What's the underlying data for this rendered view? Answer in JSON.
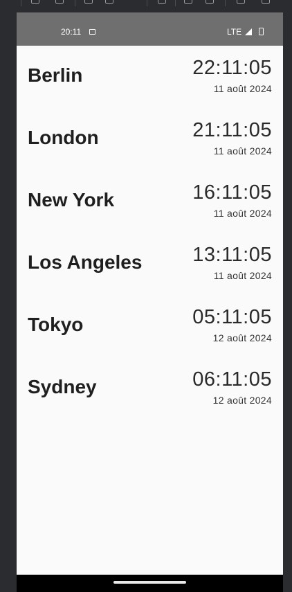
{
  "status_bar": {
    "time": "20:11",
    "network": "LTE"
  },
  "clocks": [
    {
      "city": "Berlin",
      "time": "22:11:05",
      "date": "11 août 2024"
    },
    {
      "city": "London",
      "time": "21:11:05",
      "date": "11 août 2024"
    },
    {
      "city": "New York",
      "time": "16:11:05",
      "date": "11 août 2024"
    },
    {
      "city": "Los Angeles",
      "time": "13:11:05",
      "date": "11 août 2024"
    },
    {
      "city": "Tokyo",
      "time": "05:11:05",
      "date": "12 août 2024"
    },
    {
      "city": "Sydney",
      "time": "06:11:05",
      "date": "12 août 2024"
    }
  ],
  "colors": {
    "status_bar": "#6f6f6f",
    "background": "#fafafa",
    "nav_bar": "#000000",
    "emulator_frame": "#2b2c30"
  }
}
